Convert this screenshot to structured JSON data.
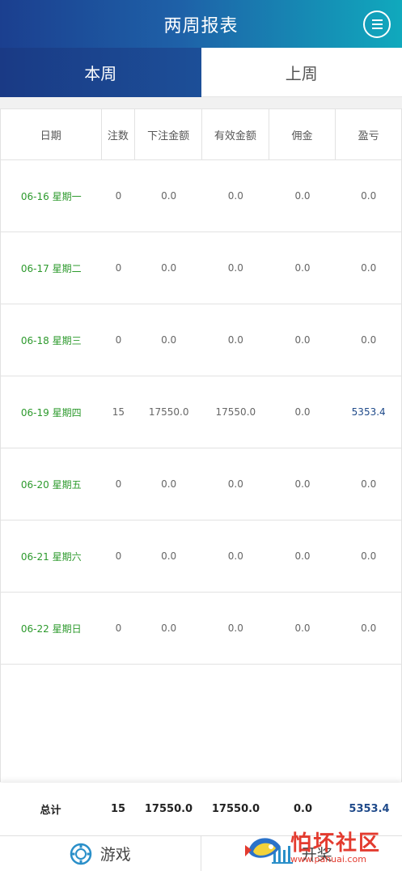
{
  "header": {
    "title": "两周报表",
    "menu_icon": "menu-icon"
  },
  "tabs": [
    {
      "label": "本周",
      "active": true
    },
    {
      "label": "上周",
      "active": false
    }
  ],
  "table": {
    "columns": [
      "日期",
      "注数",
      "下注金额",
      "有效金额",
      "佣金",
      "盈亏"
    ],
    "rows": [
      {
        "date": "06-16 星期一",
        "count": "0",
        "bet": "0.0",
        "valid": "0.0",
        "commission": "0.0",
        "profit": "0.0"
      },
      {
        "date": "06-17 星期二",
        "count": "0",
        "bet": "0.0",
        "valid": "0.0",
        "commission": "0.0",
        "profit": "0.0"
      },
      {
        "date": "06-18 星期三",
        "count": "0",
        "bet": "0.0",
        "valid": "0.0",
        "commission": "0.0",
        "profit": "0.0"
      },
      {
        "date": "06-19 星期四",
        "count": "15",
        "bet": "17550.0",
        "valid": "17550.0",
        "commission": "0.0",
        "profit": "5353.4"
      },
      {
        "date": "06-20 星期五",
        "count": "0",
        "bet": "0.0",
        "valid": "0.0",
        "commission": "0.0",
        "profit": "0.0"
      },
      {
        "date": "06-21 星期六",
        "count": "0",
        "bet": "0.0",
        "valid": "0.0",
        "commission": "0.0",
        "profit": "0.0"
      },
      {
        "date": "06-22 星期日",
        "count": "0",
        "bet": "0.0",
        "valid": "0.0",
        "commission": "0.0",
        "profit": "0.0"
      }
    ]
  },
  "total": {
    "label": "总计",
    "count": "15",
    "bet": "17550.0",
    "valid": "17550.0",
    "commission": "0.0",
    "profit": "5353.4"
  },
  "bottom_nav": [
    {
      "label": "游戏",
      "icon": "game-chip-icon"
    },
    {
      "label": "开奖",
      "icon": "bar-chart-icon"
    }
  ],
  "watermark": {
    "main": "怕坏社区",
    "sub": "www.pahuai.com"
  },
  "colors": {
    "header_start": "#1b3f8f",
    "header_end": "#10a9bd",
    "date_green": "#2d9a2d",
    "profit_blue": "#1f4a8a"
  }
}
